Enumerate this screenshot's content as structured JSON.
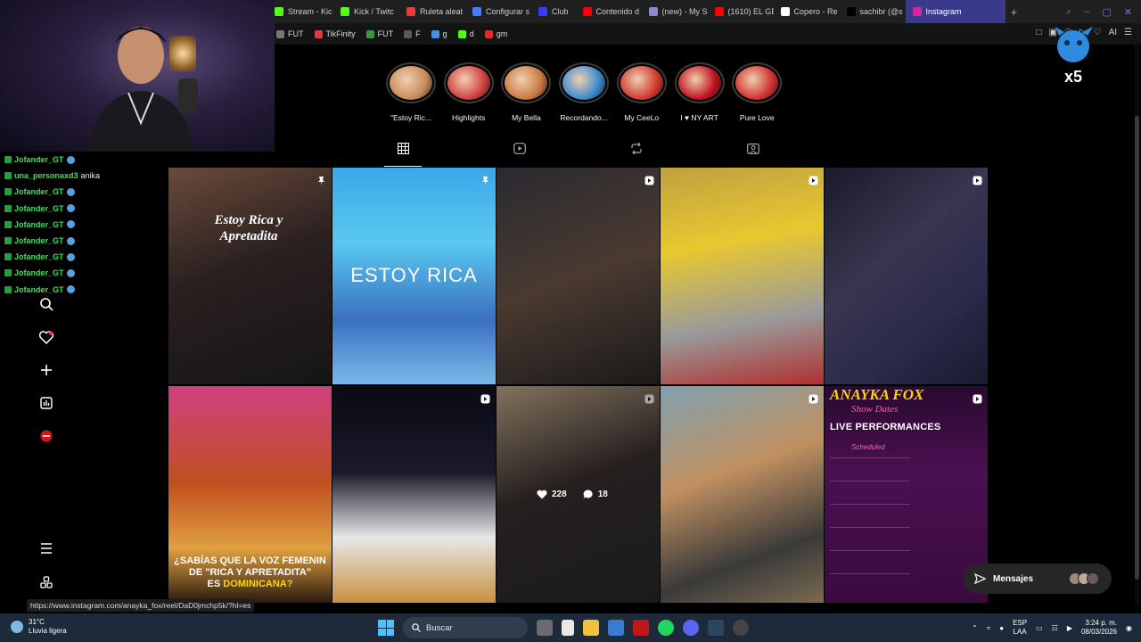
{
  "browser": {
    "tabs": [
      {
        "label": "Stream - Kic",
        "color": "#53fc18"
      },
      {
        "label": "Kick / Twitc",
        "color": "#53fc18"
      },
      {
        "label": "Ruleta aleat",
        "color": "#e83e3e"
      },
      {
        "label": "Configurar s",
        "color": "#4a7bff"
      },
      {
        "label": "Club",
        "color": "#3a3aff"
      },
      {
        "label": "Contenido d",
        "color": "#ff0000"
      },
      {
        "label": "(new) - My S",
        "color": "#8a8ad0"
      },
      {
        "label": "(1610) EL GE",
        "color": "#ff0000"
      },
      {
        "label": "Copero - Re",
        "color": "#ffffff"
      },
      {
        "label": "sachibr (@s",
        "color": "#000000"
      },
      {
        "label": "Instagram",
        "color": "#d6249f",
        "active": true
      }
    ],
    "new_tab_symbol": "+",
    "bookmarks": [
      {
        "label": "FUT",
        "color": "#777777"
      },
      {
        "label": "TikFinity",
        "color": "#e8344a"
      },
      {
        "label": "FUT",
        "color": "#2e9c3a"
      },
      {
        "label": "F",
        "color": "#5a5a5a"
      },
      {
        "label": "g",
        "color": "#4a90e2"
      },
      {
        "label": "d",
        "color": "#53fc18"
      },
      {
        "label": "gm",
        "color": "#d93025"
      }
    ],
    "addr_right_label": "AI"
  },
  "overlay": {
    "mascot_text": "x5",
    "chat": [
      {
        "user": "Jofander_GT",
        "msg": ""
      },
      {
        "user": "una_personaxd3",
        "msg": "anika"
      },
      {
        "user": "Jofander_GT",
        "msg": ""
      },
      {
        "user": "Jofander_GT",
        "msg": ""
      },
      {
        "user": "Jofander_GT",
        "msg": ""
      },
      {
        "user": "Jofander_GT",
        "msg": ""
      },
      {
        "user": "Jofander_GT",
        "msg": ""
      },
      {
        "user": "Jofander_GT",
        "msg": ""
      },
      {
        "user": "Jofander_GT",
        "msg": ""
      }
    ]
  },
  "instagram": {
    "highlights": [
      {
        "label": "\"Estoy Ric...",
        "color": "#c88a5a"
      },
      {
        "label": "Highlights",
        "color": "#d04040"
      },
      {
        "label": "My Bella",
        "color": "#c87a40"
      },
      {
        "label": "Recordando...",
        "color": "#3a8ad0"
      },
      {
        "label": "My CeeLo",
        "color": "#d03a30"
      },
      {
        "label": "I ♥ NY ART",
        "color": "#c01020"
      },
      {
        "label": "Pure Love",
        "color": "#d03030"
      }
    ],
    "profile_tabs": [
      "posts-grid",
      "reels",
      "reposts",
      "tagged"
    ],
    "posts": [
      {
        "overlay": "pin",
        "caption": "Estoy Rica y Apretadita"
      },
      {
        "overlay": "pin",
        "caption": "ESTOY RICA"
      },
      {
        "overlay": "reel",
        "caption": ""
      },
      {
        "overlay": "reel",
        "caption": ""
      },
      {
        "overlay": "reel",
        "caption": ""
      },
      {
        "overlay": "",
        "caption": "¿SABÍAS QUE LA VOZ FEMENINA DE \"RICA Y APRETADITA\" ES DOMINICANA?"
      },
      {
        "overlay": "reel",
        "caption": ""
      },
      {
        "overlay": "reel",
        "caption": ""
      },
      {
        "overlay": "reel",
        "caption": ""
      },
      {
        "overlay": "reel",
        "caption": ""
      }
    ],
    "hover_post": {
      "likes": "228",
      "comments": "18"
    },
    "flyer": {
      "title": "ANAYKA FOX",
      "subtitle": "Show Dates",
      "headline": "LIVE PERFORMANCES",
      "scheduled": "Scheduled"
    },
    "sabias_text": {
      "line1": "¿SABÍAS QUE LA VOZ FEMENIN",
      "line2": "DE \"RICA Y APRETADITA\"",
      "line3a": "ES ",
      "line3b": "DOMINICANA?"
    },
    "messages_button": "Mensajes",
    "status_url": "https://www.instagram.com/anayka_fox/reel/DaD0jmchp5k/?hl=es"
  },
  "taskbar": {
    "weather_temp": "31°C",
    "weather_desc": "Lluvia ligera",
    "search_placeholder": "Buscar",
    "lang_top": "ESP",
    "lang_bottom": "LAA",
    "time": "3:24 p. m.",
    "date": "08/03/2026"
  }
}
